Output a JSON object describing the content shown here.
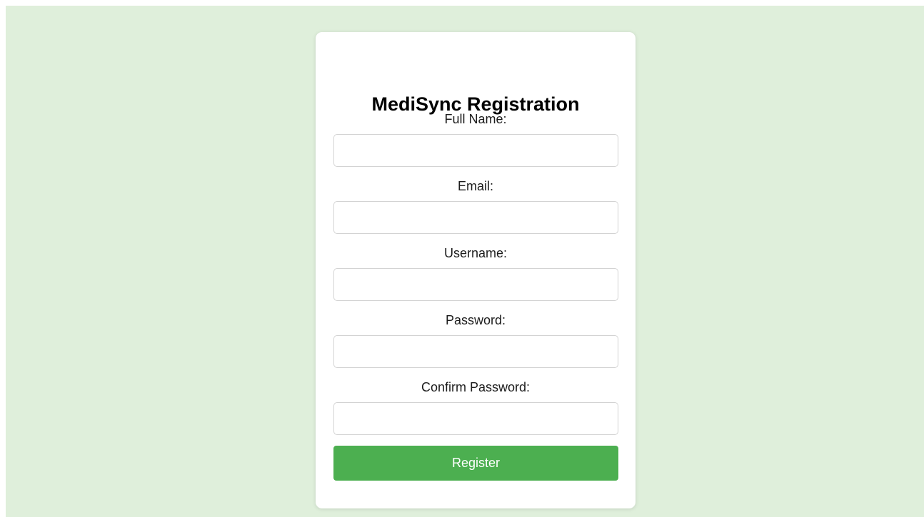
{
  "form": {
    "title": "MediSync Registration",
    "fields": [
      {
        "label": "Full Name:",
        "value": "",
        "placeholder": ""
      },
      {
        "label": "Email:",
        "value": "",
        "placeholder": ""
      },
      {
        "label": "Username:",
        "value": "",
        "placeholder": ""
      },
      {
        "label": "Password:",
        "value": "",
        "placeholder": ""
      },
      {
        "label": "Confirm Password:",
        "value": "",
        "placeholder": ""
      }
    ],
    "submit_label": "Register"
  },
  "colors": {
    "page_background": "#dfefdb",
    "card_background": "#ffffff",
    "button_background": "#4caf50",
    "button_text": "#ffffff",
    "input_border": "#d3d3d3"
  }
}
